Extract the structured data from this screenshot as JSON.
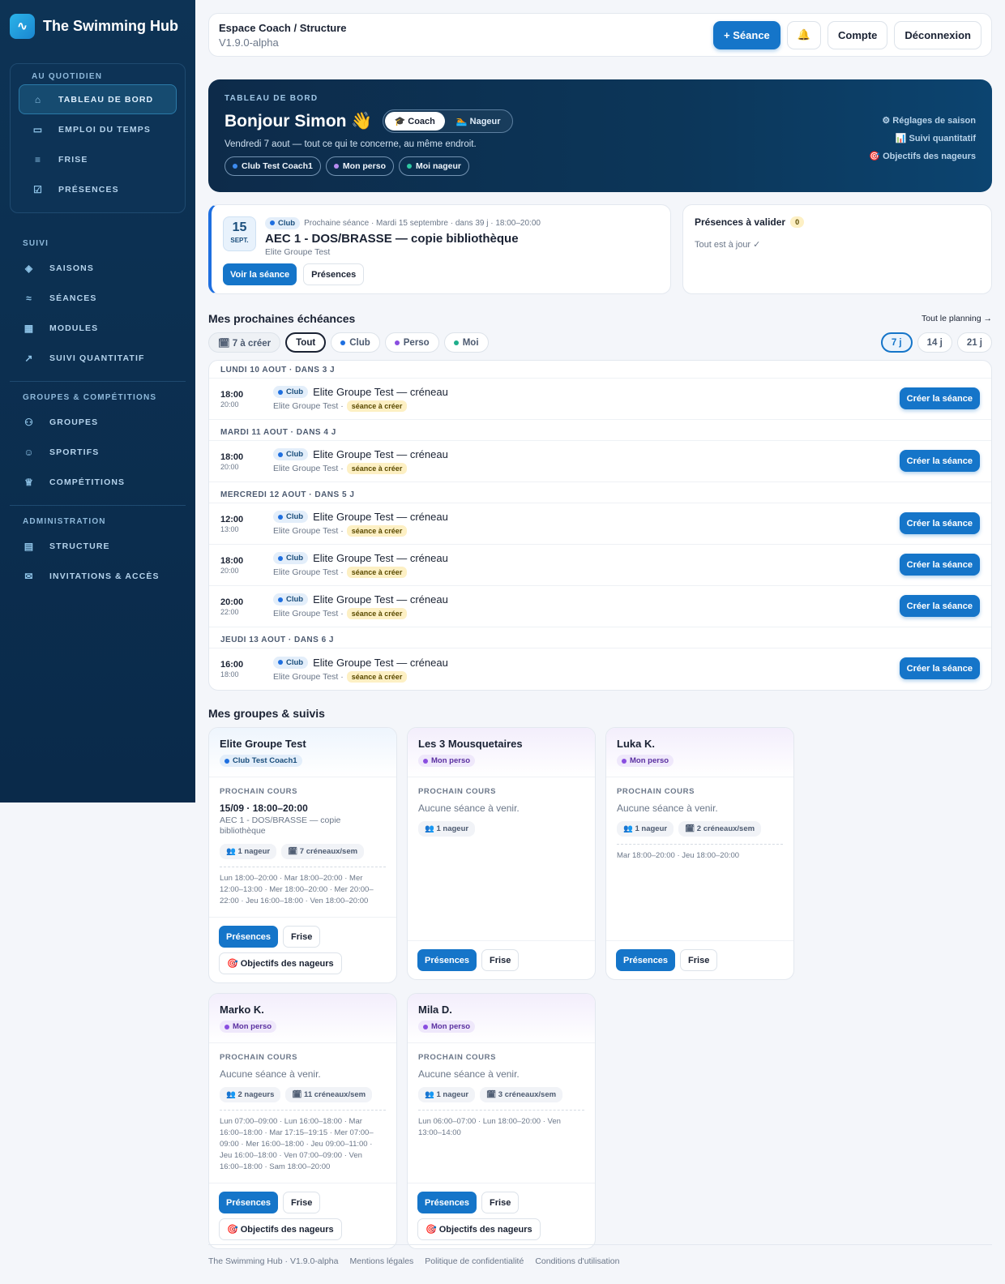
{
  "brand": {
    "name": "The Swimming Hub",
    "logo_glyph": "∿"
  },
  "sidebar": {
    "group1": {
      "label": "AU QUOTIDIEN",
      "items": [
        "TABLEAU DE BORD",
        "EMPLOI DU TEMPS",
        "FRISE",
        "PRÉSENCES"
      ]
    },
    "group2": {
      "label": "SUIVI",
      "items": [
        "SAISONS",
        "SÉANCES",
        "MODULES",
        "SUIVI QUANTITATIF"
      ]
    },
    "group3": {
      "label": "GROUPES & COMPÉTITIONS",
      "items": [
        "GROUPES",
        "SPORTIFS",
        "COMPÉTITIONS"
      ]
    },
    "group4": {
      "label": "ADMINISTRATION",
      "items": [
        "STRUCTURE",
        "INVITATIONS & ACCÈS"
      ]
    }
  },
  "topbar": {
    "title": "Espace Coach / Structure",
    "version": "V1.9.0-alpha",
    "new_session": "+ Séance",
    "bell": "🔔",
    "account": "Compte",
    "logout": "Déconnexion"
  },
  "hero": {
    "tag": "TABLEAU DE BORD",
    "hello": "Bonjour Simon",
    "wave": "👋",
    "toggle_coach": "🎓 Coach",
    "toggle_swimmer": "🏊 Nageur",
    "date": "Vendredi 7 aout — tout ce qui te concerne, au même endroit.",
    "chips": [
      "Club Test Coach1",
      "Mon perso",
      "Moi nageur"
    ],
    "links": [
      "⚙ Réglages de saison",
      "📊 Suivi quantitatif",
      "🎯 Objectifs des nageurs"
    ]
  },
  "next": {
    "day": "15",
    "month": "SEPT.",
    "badge": "Club",
    "meta": "Prochaine séance · Mardi 15 septembre · dans 39 j · 18:00–20:00",
    "title": "AEC 1 - DOS/BRASSE — copie bibliothèque",
    "sub": "Elite Groupe Test",
    "btn_view": "Voir la séance",
    "btn_presence": "Présences"
  },
  "presences": {
    "title": "Présences à valider",
    "count": "0",
    "status": "Tout est à jour ✓"
  },
  "deadlines": {
    "title": "Mes prochaines échéances",
    "link": "Tout le planning →",
    "chips": [
      "🗓 7 à créer",
      "Tout",
      "Club",
      "Perso",
      "Moi"
    ],
    "ranges": [
      "7 j",
      "14 j",
      "21 j"
    ],
    "days": [
      {
        "label": "LUNDI 10 AOUT · DANS 3 J",
        "slots": [
          {
            "start": "18:00",
            "end": "20:00"
          }
        ]
      },
      {
        "label": "MARDI 11 AOUT · DANS 4 J",
        "slots": [
          {
            "start": "18:00",
            "end": "20:00"
          }
        ]
      },
      {
        "label": "MERCREDI 12 AOUT · DANS 5 J",
        "slots": [
          {
            "start": "12:00",
            "end": "13:00"
          },
          {
            "start": "18:00",
            "end": "20:00"
          },
          {
            "start": "20:00",
            "end": "22:00"
          }
        ]
      },
      {
        "label": "JEUDI 13 AOUT · DANS 6 J",
        "slots": [
          {
            "start": "16:00",
            "end": "18:00"
          }
        ]
      }
    ],
    "slot_badge": "Club",
    "slot_title": "Elite Groupe Test — créneau",
    "slot_group": "Elite Groupe Test ·",
    "slot_warn": "séance à créer",
    "slot_btn": "Créer la séance"
  },
  "groups": {
    "title": "Mes groupes & suivis",
    "next_label": "PROCHAIN COURS",
    "none": "Aucune séance à venir.",
    "btn_presence": "Présences",
    "btn_frise": "Frise",
    "btn_goals": "🎯 Objectifs des nageurs",
    "cards": [
      {
        "name": "Elite Groupe Test",
        "badge": "Club Test Coach1",
        "next": "15/09 · 18:00–20:00",
        "next_sub": "AEC 1 - DOS/BRASSE — copie bibliothèque",
        "stat1": "👥 1 nageur",
        "stat2": "🗓 7 créneaux/sem",
        "sched": "Lun 18:00–20:00 · Mar 18:00–20:00 · Mer 12:00–13:00 · Mer 18:00–20:00 · Mer 20:00–22:00 · Jeu 16:00–18:00 · Ven 18:00–20:00"
      },
      {
        "name": "Les 3 Mousquetaires",
        "badge": "Mon perso",
        "stat1": "👥 1 nageur"
      },
      {
        "name": "Luka K.",
        "badge": "Mon perso",
        "stat1": "👥 1 nageur",
        "stat2": "🗓 2 créneaux/sem",
        "sched": "Mar 18:00–20:00 · Jeu 18:00–20:00"
      },
      {
        "name": "Marko K.",
        "badge": "Mon perso",
        "stat1": "👥 2 nageurs",
        "stat2": "🗓 11 créneaux/sem",
        "sched": "Lun 07:00–09:00 · Lun 16:00–18:00 · Mar 16:00–18:00 · Mar 17:15–19:15 · Mer 07:00–09:00 · Mer 16:00–18:00 · Jeu 09:00–11:00 · Jeu 16:00–18:00 · Ven 07:00–09:00 · Ven 16:00–18:00 · Sam 18:00–20:00"
      },
      {
        "name": "Mila D.",
        "badge": "Mon perso",
        "stat1": "👥 1 nageur",
        "stat2": "🗓 3 créneaux/sem",
        "sched": "Lun 06:00–07:00 · Lun 18:00–20:00 · Ven 13:00–14:00"
      }
    ]
  },
  "footer": [
    "The Swimming Hub · V1.9.0-alpha",
    "Mentions légales",
    "Politique de confidentialité",
    "Conditions d'utilisation"
  ],
  "colors": {
    "club": "#1e6fe0",
    "perso": "#8a4ee0",
    "moi": "#1fae8c",
    "accent": "#1575c9"
  }
}
